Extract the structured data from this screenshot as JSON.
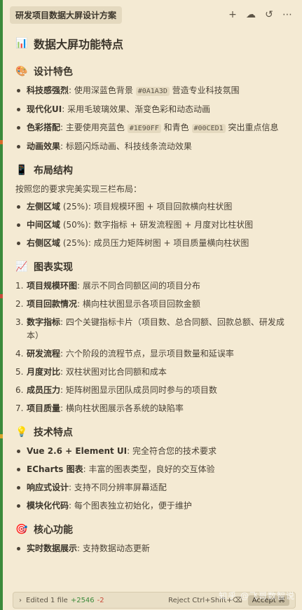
{
  "tab": {
    "title": "研发项目数据大屏设计方案"
  },
  "top_icons": [
    "plus-icon",
    "cloud-icon",
    "history-icon",
    "more-icon"
  ],
  "doc": {
    "title": "数据大屏功能特点",
    "sections": {
      "design": {
        "title": "设计特色",
        "items": [
          {
            "label": "科技感强烈",
            "pre": ": 使用深蓝色背景 ",
            "code": "#0A1A3D",
            "post": " 营造专业科技氛围"
          },
          {
            "label": "现代化UI",
            "text": ": 采用毛玻璃效果、渐变色彩和动态动画"
          },
          {
            "label": "色彩搭配",
            "pre": ": 主要使用亮蓝色 ",
            "code": "#1E90FF",
            "mid": " 和青色 ",
            "code2": "#00CED1",
            "post": " 突出重点信息"
          },
          {
            "label": "动画效果",
            "text": ": 标题闪烁动画、科技线条流动效果"
          }
        ]
      },
      "layout": {
        "title": "布局结构",
        "intro": "按照您的要求完美实现三栏布局：",
        "items": [
          {
            "label": "左侧区域",
            "text": " (25%): 项目规模环图 + 项目回款横向柱状图"
          },
          {
            "label": "中间区域",
            "text": " (50%): 数字指标 + 研发流程图 + 月度对比柱状图"
          },
          {
            "label": "右侧区域",
            "text": " (25%): 成员压力矩阵树图 + 项目质量横向柱状图"
          }
        ]
      },
      "charts": {
        "title": "图表实现",
        "items": [
          {
            "num": "1.",
            "label": "项目规模环图",
            "text": ": 展示不同合同额区间的项目分布"
          },
          {
            "num": "2.",
            "label": "项目回款情况",
            "text": ": 横向柱状图显示各项目回款金额"
          },
          {
            "num": "3.",
            "label": "数字指标",
            "text": ": 四个关键指标卡片（项目数、总合同额、回款总额、研发成本）"
          },
          {
            "num": "4.",
            "label": "研发流程",
            "text": ": 六个阶段的流程节点，显示项目数量和延误率"
          },
          {
            "num": "5.",
            "label": "月度对比",
            "text": ": 双柱状图对比合同额和成本"
          },
          {
            "num": "6.",
            "label": "成员压力",
            "text": ": 矩阵树图显示团队成员同时参与的项目数"
          },
          {
            "num": "7.",
            "label": "项目质量",
            "text": ": 横向柱状图展示各系统的缺陷率"
          }
        ]
      },
      "tech": {
        "title": "技术特点",
        "items": [
          {
            "label": "Vue 2.6 + Element UI",
            "text": ": 完全符合您的技术要求"
          },
          {
            "label": "ECharts 图表",
            "text": ": 丰富的图表类型，良好的交互体验"
          },
          {
            "label": "响应式设计",
            "text": ": 支持不同分辨率屏幕适配"
          },
          {
            "label": "模块化代码",
            "text": ": 每个图表独立初始化，便于维护"
          }
        ]
      },
      "core": {
        "title": "核心功能",
        "items": [
          {
            "label": "实时数据展示",
            "text": ": 支持数据动态更新"
          }
        ]
      }
    }
  },
  "status": {
    "edited": "Edited 1 file",
    "added": "+2546",
    "removed": "-2",
    "reject": "Reject Ctrl+Shift+⌫",
    "accept": "Accept ⌘"
  },
  "watermark": "知乎 @飞哥数智说"
}
